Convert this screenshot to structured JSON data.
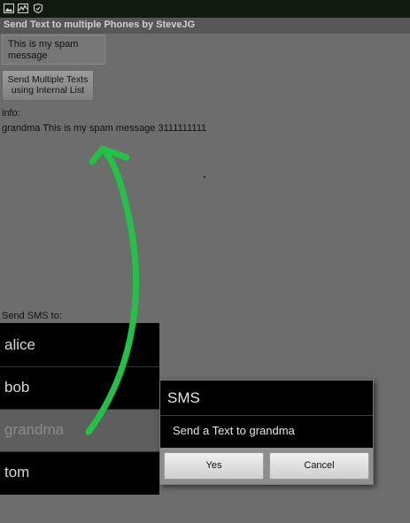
{
  "status_bar": {
    "icons": [
      "image-icon",
      "activity-icon",
      "shield-icon"
    ]
  },
  "app": {
    "title": "Send Text to multiple Phones by SteveJG"
  },
  "message_box": {
    "text": "This is my spam message"
  },
  "send_button": {
    "label": "Send Multiple Texts using Internal List"
  },
  "info": {
    "label": "info:",
    "content": "grandma  This is my spam message  3111111111"
  },
  "recipients": {
    "label": "Send SMS to:",
    "items": [
      "alice",
      "bob",
      "grandma",
      "tom"
    ],
    "selected": "grandma"
  },
  "dialog": {
    "title": "SMS",
    "message": "Send a Text to grandma",
    "yes_label": "Yes",
    "cancel_label": "Cancel"
  },
  "colors": {
    "screen_background": "#6d6d6d",
    "status_bar": "#131a0e",
    "list_background": "#000000",
    "selected_row": "#5e5e5e",
    "annotation_arrow": "#22c247"
  }
}
